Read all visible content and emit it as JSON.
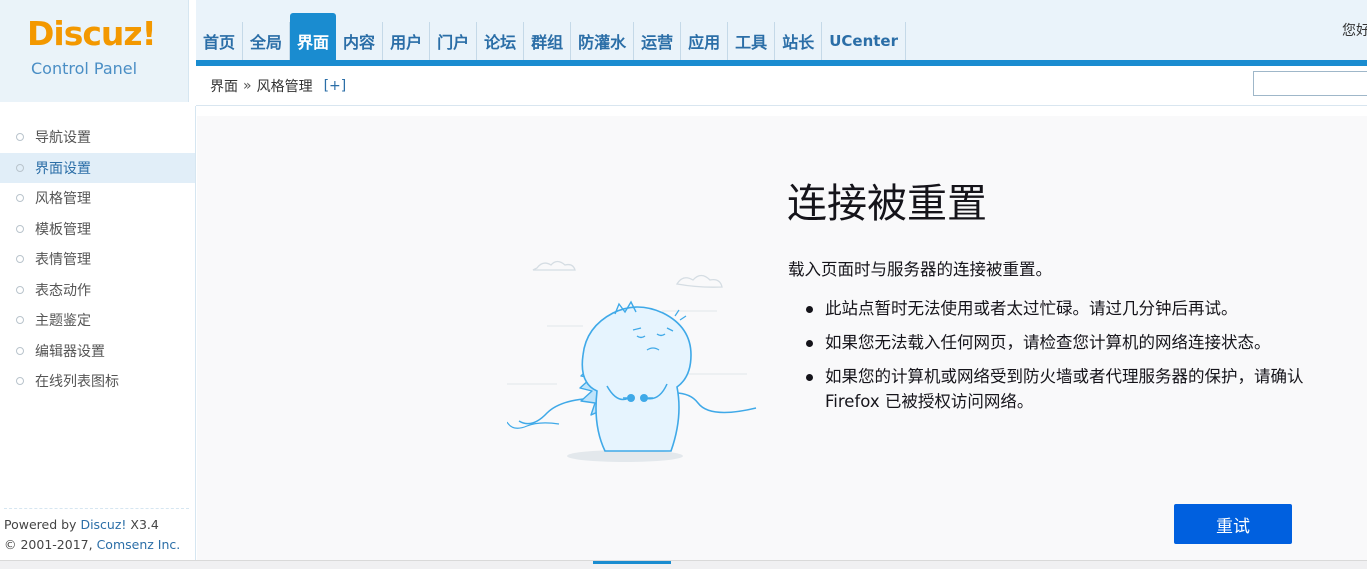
{
  "logo": {
    "brand": "Discuz!",
    "subtitle": "Control Panel"
  },
  "topnav": {
    "items": [
      {
        "label": "首页",
        "active": false
      },
      {
        "label": "全局",
        "active": false
      },
      {
        "label": "界面",
        "active": true
      },
      {
        "label": "内容",
        "active": false
      },
      {
        "label": "用户",
        "active": false
      },
      {
        "label": "门户",
        "active": false
      },
      {
        "label": "论坛",
        "active": false
      },
      {
        "label": "群组",
        "active": false
      },
      {
        "label": "防灌水",
        "active": false
      },
      {
        "label": "运营",
        "active": false
      },
      {
        "label": "应用",
        "active": false
      },
      {
        "label": "工具",
        "active": false
      },
      {
        "label": "站长",
        "active": false
      },
      {
        "label": "UCenter",
        "active": false
      }
    ],
    "greeting": "您好"
  },
  "breadcrumb": {
    "section": "界面",
    "separator": "»",
    "page": "风格管理",
    "add": "[+]"
  },
  "sidebar": {
    "items": [
      {
        "label": "导航设置"
      },
      {
        "label": "界面设置"
      },
      {
        "label": "风格管理"
      },
      {
        "label": "模板管理"
      },
      {
        "label": "表情管理"
      },
      {
        "label": "表态动作"
      },
      {
        "label": "主题鉴定"
      },
      {
        "label": "编辑器设置"
      },
      {
        "label": "在线列表图标"
      }
    ],
    "active_index": 1,
    "powered_prefix": "Powered by ",
    "powered_product": "Discuz!",
    "powered_version": " X3.4",
    "copyright_prefix": "© 2001-2017, ",
    "copyright_company": "Comsenz Inc."
  },
  "error": {
    "title": "连接被重置",
    "description": "载入页面时与服务器的连接被重置。",
    "items": [
      "此站点暂时无法使用或者太过忙碌。请过几分钟后再试。",
      "如果您无法载入任何网页，请检查您计算机的网络连接状态。",
      "如果您的计算机或网络受到防火墙或者代理服务器的保护，请确认 Firefox 已被授权访问网络。"
    ],
    "retry_label": "重试"
  },
  "colors": {
    "accent": "#1a8cd0",
    "logo_orange": "#f39800",
    "link_blue": "#2b6ea7",
    "retry_blue": "#0060df",
    "illustration_blue": "#3fa9e8"
  },
  "icons": {
    "illustration": "unplugged-dinosaur-icon",
    "sidebar_bullet": "circle-bullet-icon"
  }
}
